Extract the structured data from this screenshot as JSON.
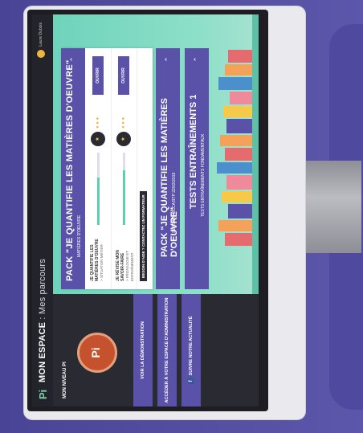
{
  "topbar": {
    "logo": "Pi",
    "title_bold": "MON ESPACE",
    "title_sep": " : ",
    "title_sub": "Mes parcours",
    "user": "Laure Dubois"
  },
  "sidebar": {
    "level_title": "MON NIVEAU PI",
    "badge": "Pi",
    "demo_button": "VOIR LA DÉMONSTRATION",
    "admin_button": "ACCÉDER À VOTRE ESPACE D'ADMINISTRATION",
    "news_button": "SUIVRE NOTRE ACTUALITÉ",
    "fb": "f"
  },
  "packs": [
    {
      "title": "PACK \"JE QUANTIFIE LES MATIÈRES D'OEUVRE\"",
      "subtitle": "MATIÈRES D'OEUVRE",
      "rows": [
        {
          "label": "JE QUANTIFIE LES MATIÈRES D'OEUVRE",
          "sub": "> SITUATION MÉTIER",
          "progress": 0.65,
          "open": "OUVRIR"
        },
        {
          "label": "JE RÉVISE MON SAVOIR-FAIRE",
          "sub": "> PÉDAGOGIE ET ENTRAÎNEMENT",
          "progress": 0.75,
          "open": "OUVRIR"
        }
      ],
      "note": "BESOIN D'AIDE ? CONTACTEZ UN FORMATEUR"
    },
    {
      "title": "PACK \"JE QUANTIFIE LES MATIÈRES D'OEUVRE\"",
      "subtitle": "SESSION OCCA BTP 22/03/2018"
    },
    {
      "title": "TESTS ENTRAÎNEMENTS 1",
      "subtitle": "TESTS ENTRAÎNEMENTS FONDAMENTAUX"
    }
  ],
  "colors": {
    "accent": "#5a52a8",
    "mint": "#6fd3bc",
    "dark": "#2a2a33"
  }
}
